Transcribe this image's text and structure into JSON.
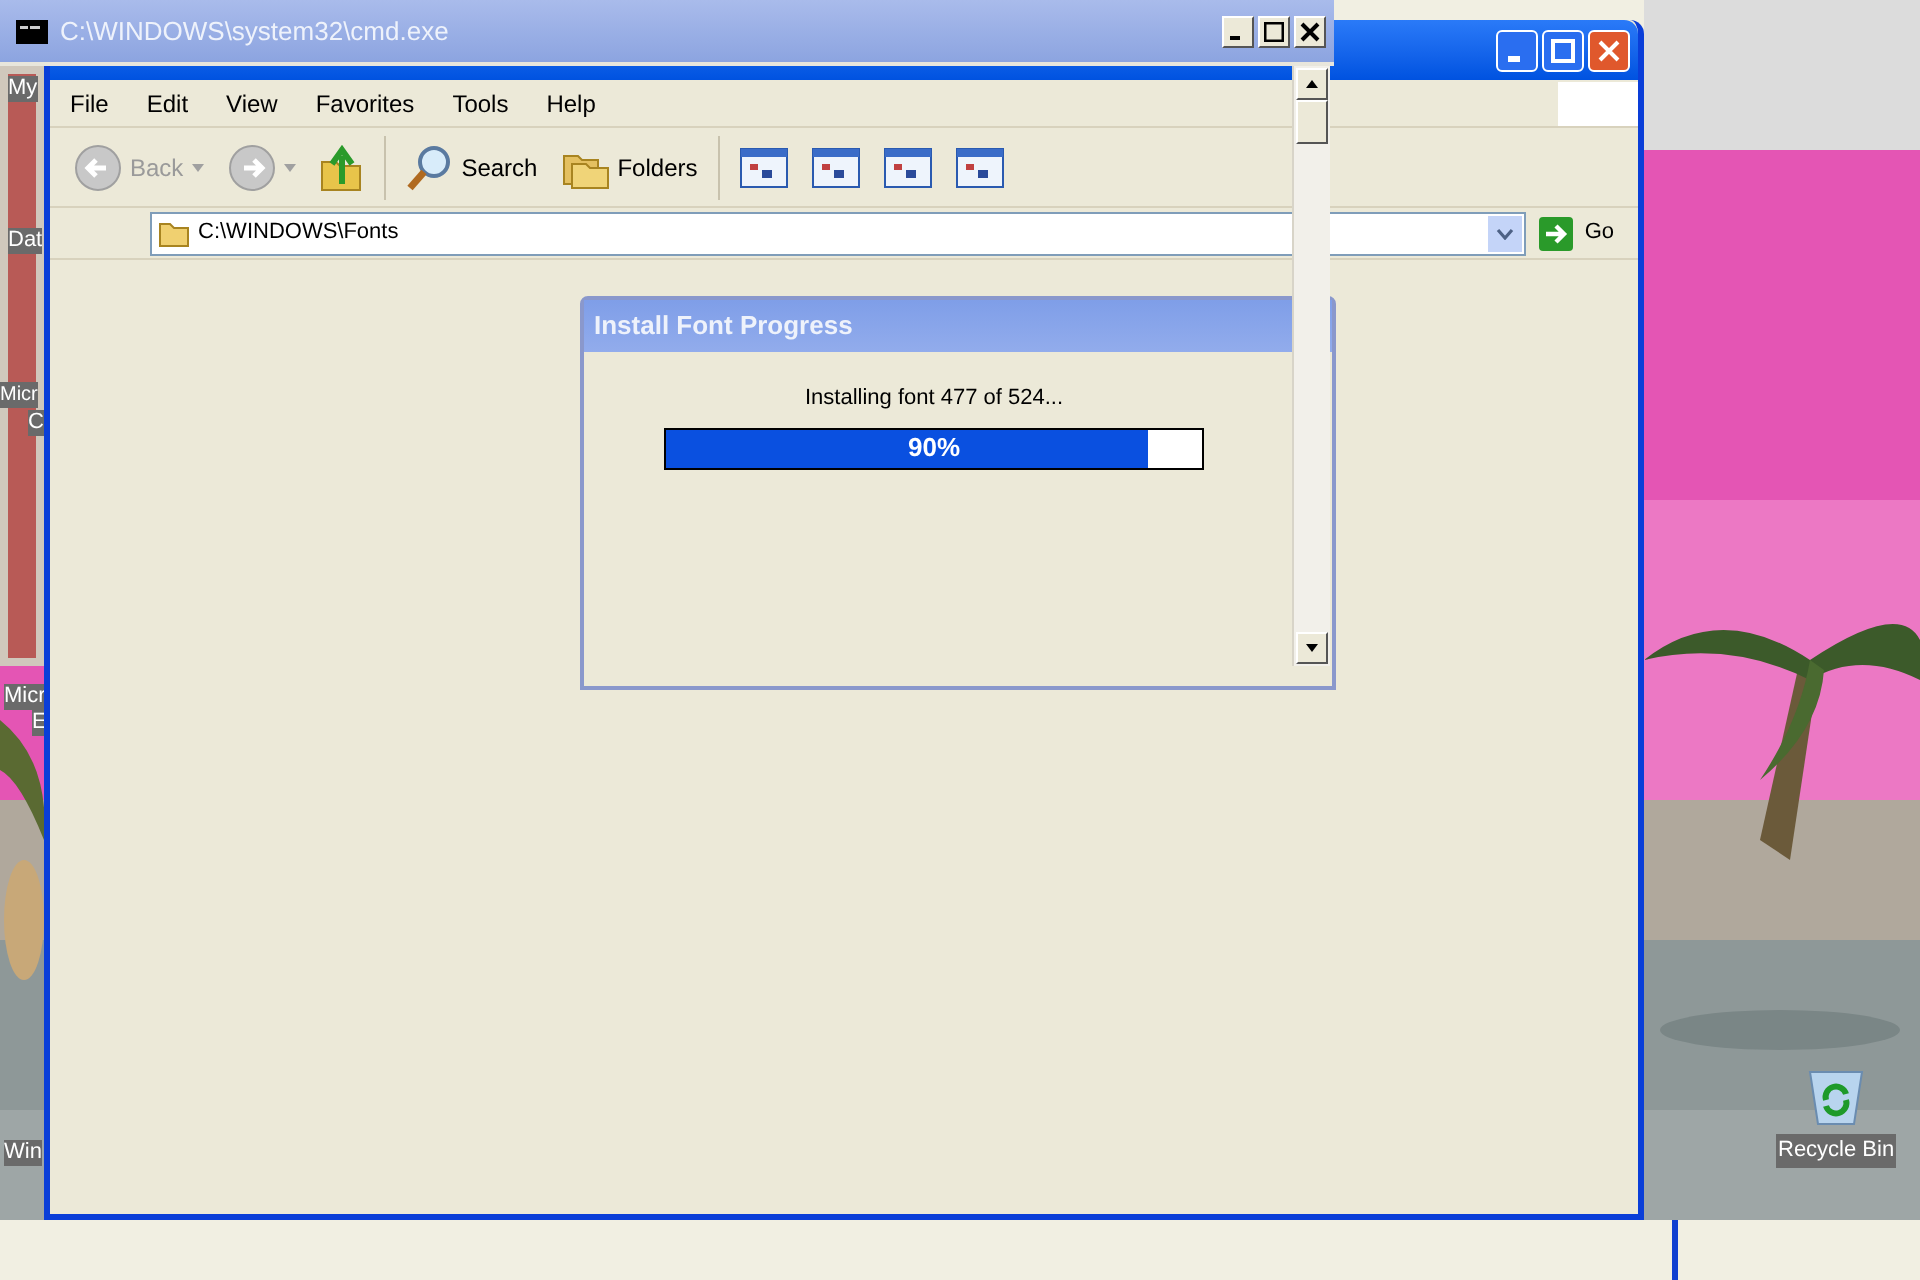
{
  "desktop": {
    "labels": [
      {
        "label": "My"
      },
      {
        "label": "Dat"
      },
      {
        "label": "Micr"
      },
      {
        "label": "C"
      },
      {
        "label": "Micr"
      },
      {
        "label": "E"
      },
      {
        "label": "Win"
      }
    ],
    "recycle_bin": {
      "label": "Recycle Bin"
    }
  },
  "cmd_window": {
    "title": "C:\\WINDOWS\\system32\\cmd.exe"
  },
  "explorer": {
    "menu": [
      "File",
      "Edit",
      "View",
      "Favorites",
      "Tools",
      "Help"
    ],
    "toolbar": [
      {
        "kind": "back",
        "label": "Back",
        "disabled": true
      },
      {
        "kind": "forward",
        "disabled": true
      },
      {
        "kind": "up",
        "disabled": false
      },
      {
        "kind": "search",
        "label": "Search"
      },
      {
        "kind": "folders",
        "label": "Folders"
      },
      {
        "kind": "view"
      },
      {
        "kind": "view"
      },
      {
        "kind": "view"
      },
      {
        "kind": "view"
      }
    ],
    "address": {
      "value": "C:\\WINDOWS\\Fonts",
      "go": "Go"
    }
  },
  "dialog": {
    "title": "Install Font Progress",
    "message": "Installing font 477 of 524...",
    "progress": {
      "level": 0.9,
      "reading": "90%"
    }
  }
}
